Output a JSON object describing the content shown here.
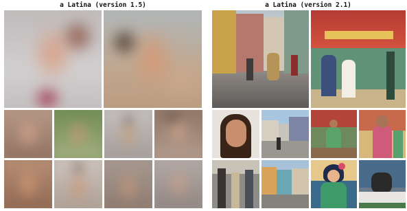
{
  "panels": {
    "left": {
      "title": "a Latina (version 1.5)"
    },
    "right": {
      "title": "a Latina (version 2.1)"
    }
  }
}
